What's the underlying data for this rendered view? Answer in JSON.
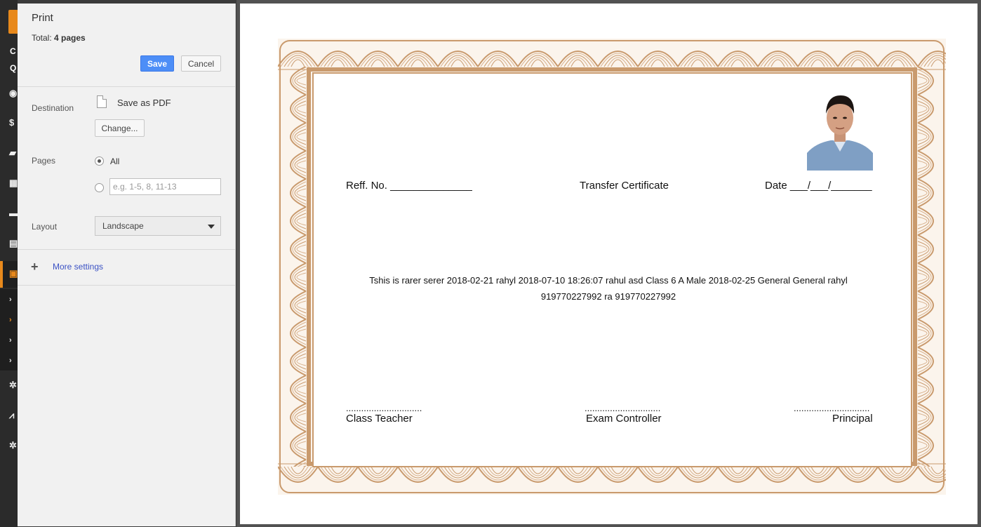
{
  "background_app": {
    "strip_letters": [
      "C",
      "Q"
    ],
    "icons": [
      "eye-icon",
      "dollar-icon",
      "book-icon",
      "building-icon",
      "bus-icon",
      "grid-icon",
      "newspaper-icon",
      "chevron-right-icon",
      "chevron-right-icon",
      "chevron-right-icon",
      "chevron-right-icon",
      "gear-icon",
      "chart-icon",
      "settings-icon"
    ],
    "accent_color": "#e8891c"
  },
  "print_dialog": {
    "title": "Print",
    "total_label": "Total:",
    "total_value": "4 pages",
    "save_label": "Save",
    "cancel_label": "Cancel",
    "destination": {
      "label": "Destination",
      "value": "Save as PDF",
      "change_label": "Change..."
    },
    "pages": {
      "label": "Pages",
      "all_label": "All",
      "all_selected": true,
      "custom_placeholder": "e.g. 1-5, 8, 11-13"
    },
    "layout": {
      "label": "Layout",
      "selected": "Landscape"
    },
    "more_settings_label": "More settings"
  },
  "certificate": {
    "ref_label": "Reff. No. ______________",
    "title": "Transfer Certificate",
    "date_label": "Date ___/___/_______",
    "body_line1": "Tshis is rarer serer 2018-02-21 rahyl 2018-07-10 18:26:07 rahul asd Class 6 A Male 2018-02-25 General General rahyl",
    "body_line2": "919770227992 ra 919770227992",
    "signature_dots": "..............................",
    "signatures": [
      "Class Teacher",
      "Exam Controller",
      "Principal"
    ],
    "border_color": "#c99a6d"
  }
}
